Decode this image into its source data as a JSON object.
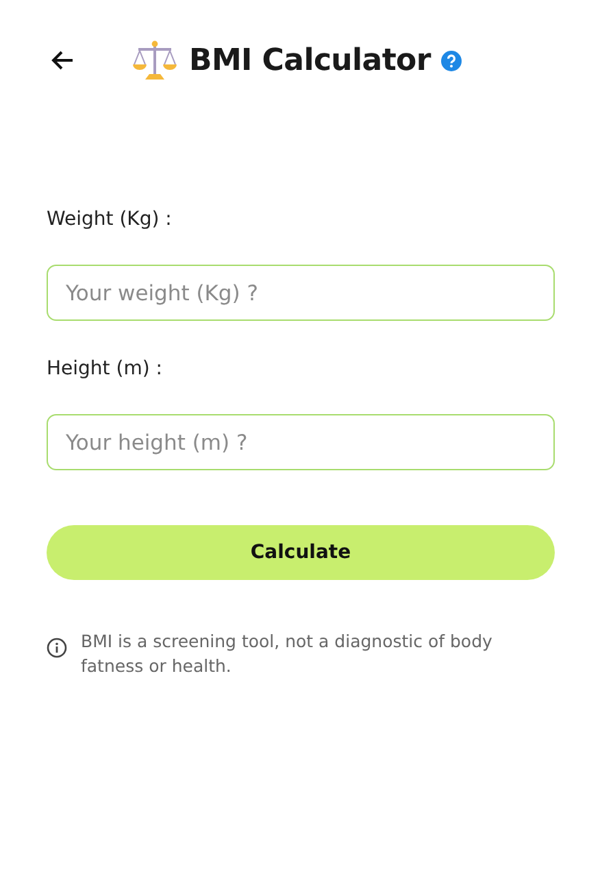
{
  "header": {
    "title": "BMI Calculator"
  },
  "fields": [
    {
      "label": "Weight (Kg) :",
      "placeholder": "Your weight (Kg) ?"
    },
    {
      "label": "Height (m) :",
      "placeholder": "Your height (m) ?"
    }
  ],
  "button": {
    "label": "Calculate"
  },
  "note": "BMI is a screening tool, not a diagnostic of body fatness or health."
}
